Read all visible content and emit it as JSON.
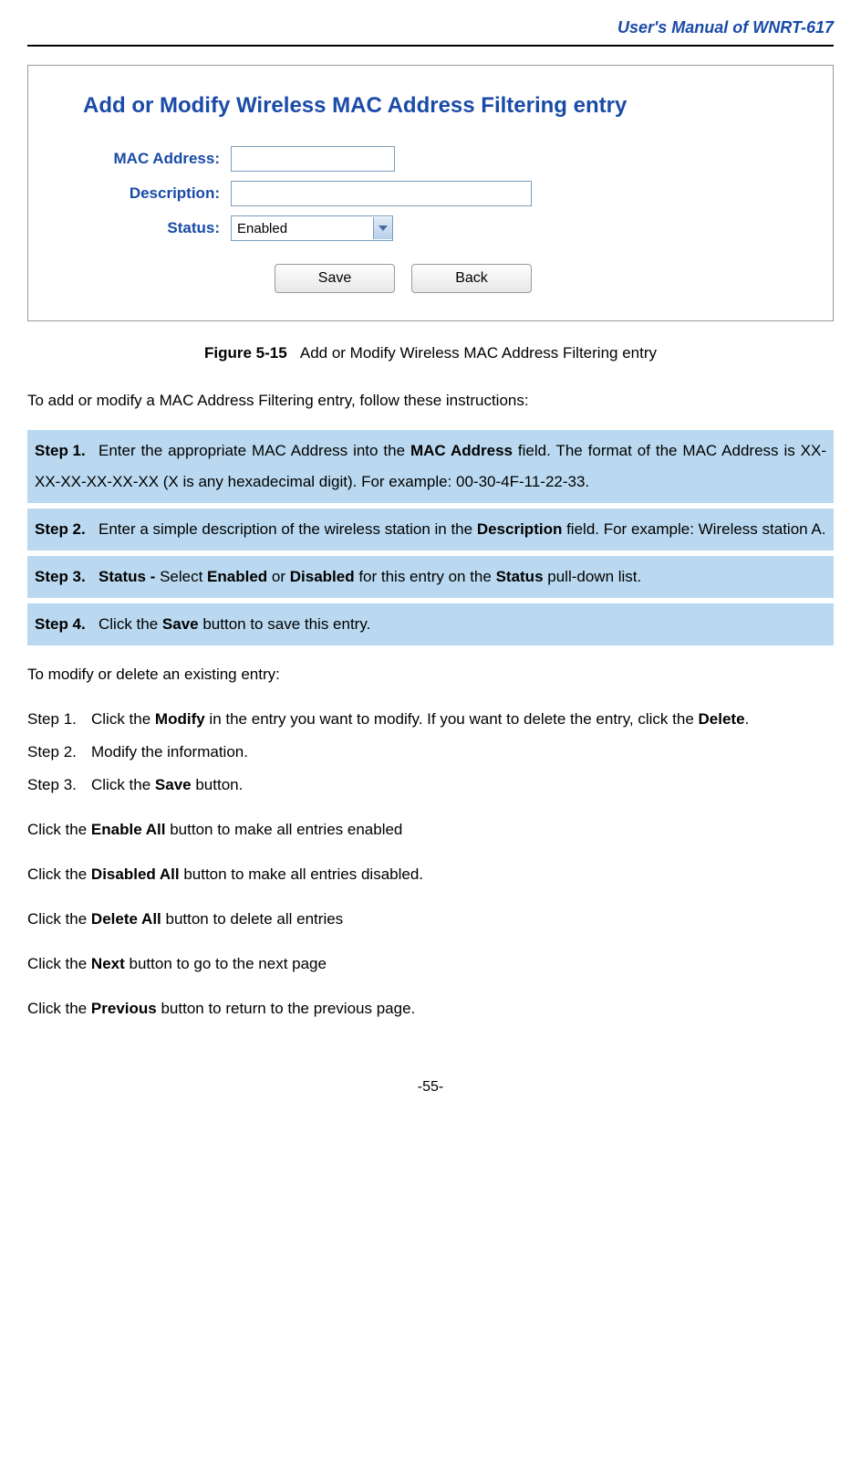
{
  "header": {
    "title": "User's Manual of WNRT-617"
  },
  "figure": {
    "form_title": "Add or Modify Wireless MAC Address Filtering entry",
    "labels": {
      "mac": "MAC Address:",
      "desc": "Description:",
      "status": "Status:"
    },
    "status_value": "Enabled",
    "buttons": {
      "save": "Save",
      "back": "Back"
    }
  },
  "caption": {
    "num": "Figure 5-15",
    "text": "Add or Modify Wireless MAC Address Filtering entry"
  },
  "intro": "To add or modify a MAC Address Filtering entry, follow these instructions:",
  "steps": [
    {
      "label": "Step 1.",
      "parts": [
        {
          "t": "plain",
          "v": "Enter the appropriate MAC Address into the "
        },
        {
          "t": "bold",
          "v": "MAC Address"
        },
        {
          "t": "plain",
          "v": " field. The format of the MAC Address is XX-XX-XX-XX-XX-XX (X is any hexadecimal digit). For example: 00-30-4F-11-22-33."
        }
      ]
    },
    {
      "label": "Step 2.",
      "parts": [
        {
          "t": "plain",
          "v": "Enter a simple description of the wireless station in the "
        },
        {
          "t": "bold",
          "v": "Description"
        },
        {
          "t": "plain",
          "v": " field. For example: Wireless station A."
        }
      ]
    },
    {
      "label": "Step 3.",
      "parts": [
        {
          "t": "bold",
          "v": "Status - "
        },
        {
          "t": "plain",
          "v": "Select "
        },
        {
          "t": "bold",
          "v": "Enabled"
        },
        {
          "t": "plain",
          "v": " or "
        },
        {
          "t": "bold",
          "v": "Disabled"
        },
        {
          "t": "plain",
          "v": " for this entry on the "
        },
        {
          "t": "bold",
          "v": "Status"
        },
        {
          "t": "plain",
          "v": " pull-down list."
        }
      ]
    },
    {
      "label": "Step 4.",
      "parts": [
        {
          "t": "plain",
          "v": "Click the "
        },
        {
          "t": "bold",
          "v": "Save"
        },
        {
          "t": "plain",
          "v": " button to save this entry."
        }
      ]
    }
  ],
  "modify_intro": "To modify or delete an existing entry:",
  "modify_steps": [
    {
      "label": "Step 1.",
      "parts": [
        {
          "t": "plain",
          "v": "Click the "
        },
        {
          "t": "bold",
          "v": "Modify"
        },
        {
          "t": "plain",
          "v": " in the entry you want to modify. If you want to delete the entry, click the "
        },
        {
          "t": "bold",
          "v": "Delete"
        },
        {
          "t": "plain",
          "v": "."
        }
      ]
    },
    {
      "label": "Step 2.",
      "parts": [
        {
          "t": "plain",
          "v": "Modify the information."
        }
      ]
    },
    {
      "label": "Step 3.",
      "parts": [
        {
          "t": "plain",
          "v": "Click the "
        },
        {
          "t": "bold",
          "v": "Save"
        },
        {
          "t": "plain",
          "v": " button."
        }
      ]
    }
  ],
  "bottom_lines": [
    [
      {
        "t": "plain",
        "v": "Click the "
      },
      {
        "t": "bold",
        "v": "Enable All"
      },
      {
        "t": "plain",
        "v": " button to make all entries enabled"
      }
    ],
    [
      {
        "t": "plain",
        "v": "Click the "
      },
      {
        "t": "bold",
        "v": "Disabled All"
      },
      {
        "t": "plain",
        "v": " button to make all entries disabled."
      }
    ],
    [
      {
        "t": "plain",
        "v": "Click the "
      },
      {
        "t": "bold",
        "v": "Delete All"
      },
      {
        "t": "plain",
        "v": " button to delete all entries"
      }
    ],
    [
      {
        "t": "plain",
        "v": "Click the "
      },
      {
        "t": "bold",
        "v": "Next"
      },
      {
        "t": "plain",
        "v": " button to go to the next page"
      }
    ],
    [
      {
        "t": "plain",
        "v": "Click the "
      },
      {
        "t": "bold",
        "v": "Previous"
      },
      {
        "t": "plain",
        "v": " button to return to the previous page."
      }
    ]
  ],
  "footer": "-55-"
}
